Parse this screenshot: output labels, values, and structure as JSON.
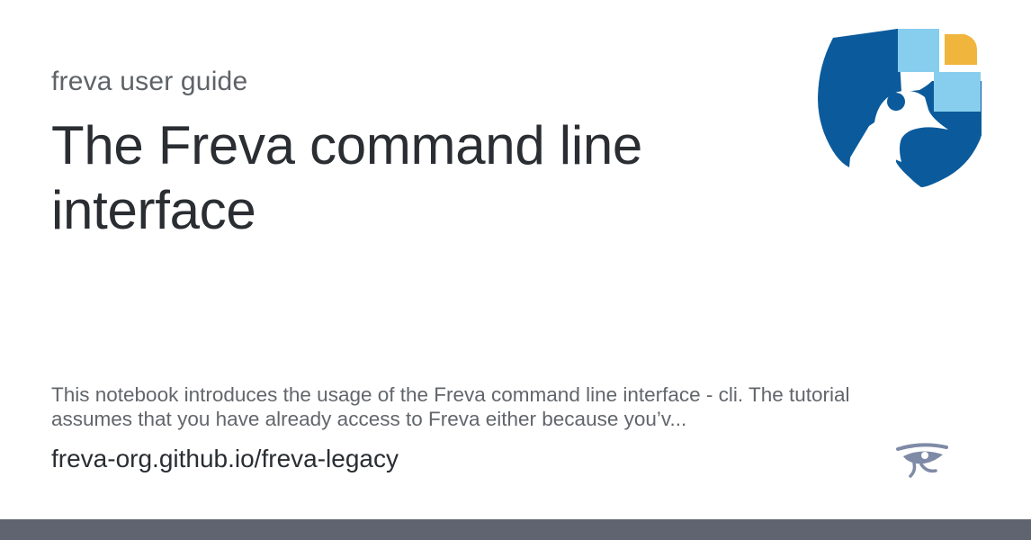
{
  "card": {
    "site_name": "freva user guide",
    "title": "The Freva command line interface",
    "description": "This notebook introduces the usage of the Freva command line interface - cli. The tutorial assumes that you have already access to Freva either because you’v...",
    "url": "freva-org.github.io/freva-legacy"
  },
  "icons": {
    "logo": "freva-penguin-logo-icon",
    "badge": "eye-of-horus-icon"
  },
  "colors": {
    "logo_dark_blue": "#0b5b9c",
    "logo_light_blue": "#87cdee",
    "logo_orange": "#f0b53c",
    "badge": "#7f8aa6",
    "bottom_bar": "#5f6470"
  }
}
